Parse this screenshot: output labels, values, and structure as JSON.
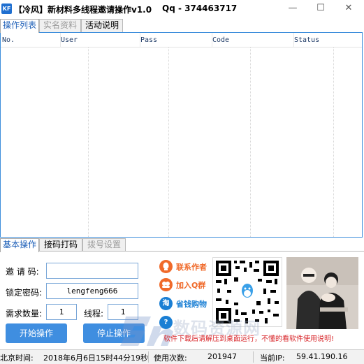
{
  "window": {
    "icon_label": "KF",
    "title": "【冷风】新材料多线程邀请操作v1.0",
    "qq": "Qq - 374463717",
    "minimize_glyph": "—",
    "maximize_glyph": "☐",
    "close_glyph": "✕"
  },
  "top_tabs": [
    {
      "label": "操作列表",
      "state": "active"
    },
    {
      "label": "实名资料",
      "state": "disabled"
    },
    {
      "label": "活动说明",
      "state": "normal"
    }
  ],
  "list": {
    "columns": [
      "No.",
      "User",
      "Pass",
      "Code",
      "Status"
    ],
    "rows": []
  },
  "bottom_tabs": [
    {
      "label": "基本操作",
      "state": "active"
    },
    {
      "label": "接码打码",
      "state": "normal"
    },
    {
      "label": "拨号设置",
      "state": "disabled"
    }
  ],
  "form": {
    "invite_code_label": "邀 请 码:",
    "invite_code_value": "",
    "lock_password_label": "锁定密码:",
    "lock_password_value": "lengfeng666",
    "quantity_label": "需求数量:",
    "quantity_value": "1",
    "threads_label": "线程:",
    "threads_value": "1",
    "start_button": "开始操作",
    "stop_button": "停止操作"
  },
  "links": [
    {
      "label": "联系作者",
      "icon": "qq-icon",
      "color": "#f06a2a"
    },
    {
      "label": "加入Q群",
      "icon": "group-icon",
      "color": "#f06a2a"
    },
    {
      "label": "省钱购物",
      "icon": "taobao-icon",
      "color": "#1a7fd4"
    },
    {
      "label": "",
      "icon": "help-icon",
      "color": "#1a7fd4"
    }
  ],
  "notice": "软件下载后请解压到桌面运行，不懂的看软件使用说明!",
  "watermark": "数码资源网",
  "status": {
    "time_label": "北京时间:",
    "time_value": "2018年6月6日15时44分19秒",
    "usage_label": "使用次数:",
    "usage_value": "201947",
    "ip_label": "当前IP:",
    "ip_value": "59.41.190.16"
  },
  "colors": {
    "accent": "#3f8ee0",
    "list_border": "#3c8ddb",
    "active_tab_text": "#1d5fb8",
    "notice": "#d8262a"
  }
}
